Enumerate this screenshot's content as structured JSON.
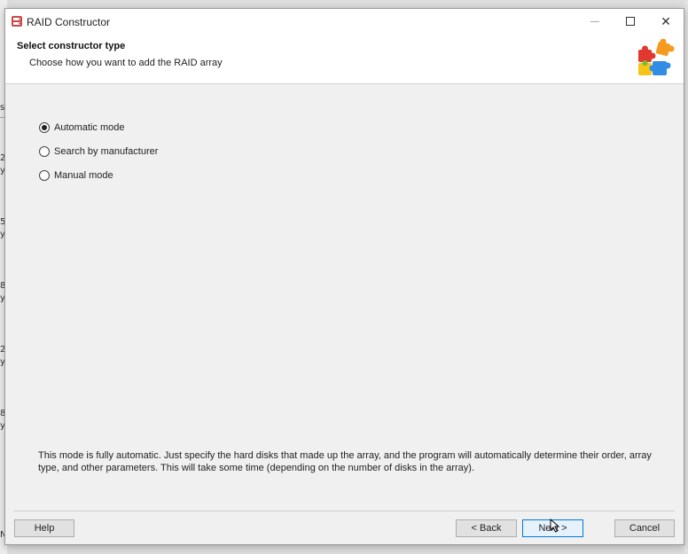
{
  "background": {
    "fragments": [
      "si",
      "2",
      "y",
      "5",
      "y",
      "8",
      "y",
      "2",
      "y",
      "8",
      "y",
      "N"
    ]
  },
  "window": {
    "title": "RAID Constructor",
    "controls": {
      "minimize": "minimize",
      "maximize": "maximize",
      "close": "✕"
    }
  },
  "header": {
    "title": "Select constructor type",
    "subtitle": "Choose how you want to add the RAID array",
    "icon": "puzzle-icon"
  },
  "options": [
    {
      "label": "Automatic mode",
      "selected": true
    },
    {
      "label": "Search by manufacturer",
      "selected": false
    },
    {
      "label": "Manual mode",
      "selected": false
    }
  ],
  "description": "This mode is fully automatic. Just specify the hard disks that made up the array, and the program will automatically determine their order, array type, and other parameters. This will take some time (depending on the number of disks in the array).",
  "buttons": {
    "help": "Help",
    "back": "< Back",
    "next": "Next >",
    "cancel": "Cancel"
  },
  "colors": {
    "accent": "#0078d7",
    "puzzle_red": "#e2382f",
    "puzzle_orange": "#f39a1f",
    "puzzle_yellow": "#f5c518",
    "puzzle_blue": "#2f8de4",
    "puzzle_green": "#6cbf3a"
  }
}
